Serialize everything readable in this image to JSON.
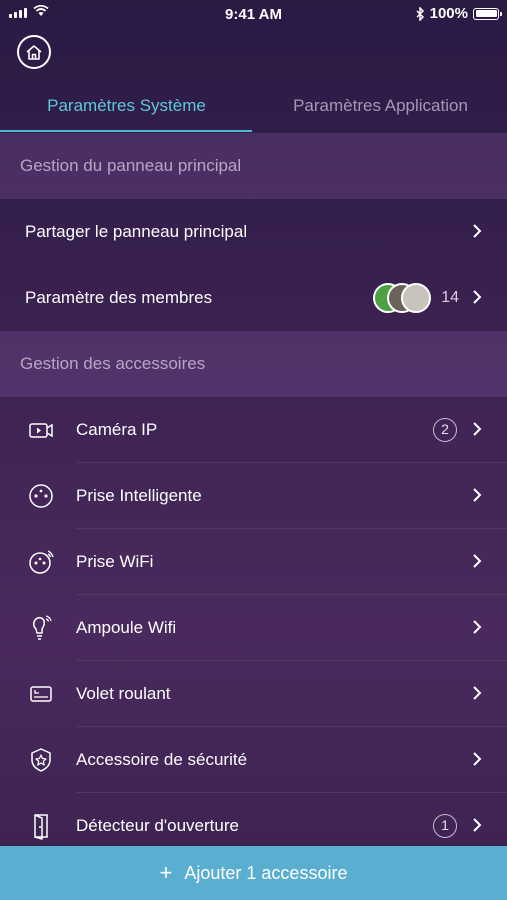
{
  "status_bar": {
    "time": "9:41 AM",
    "battery": "100%",
    "battery_level": 1.0
  },
  "tabs": [
    {
      "label": "Paramètres Système",
      "active": true
    },
    {
      "label": "Paramètres Application",
      "active": false
    }
  ],
  "sections": {
    "main_panel": {
      "title": "Gestion du panneau principal",
      "items": {
        "share": {
          "label": "Partager le panneau principal"
        },
        "members": {
          "label": "Paramètre des membres",
          "count": "14"
        }
      }
    },
    "accessories": {
      "title": "Gestion des accessoires",
      "items": [
        {
          "label": "Caméra IP",
          "icon": "camera-icon",
          "badge": "2"
        },
        {
          "label": "Prise Intelligente",
          "icon": "smart-plug-icon"
        },
        {
          "label": "Prise WiFi",
          "icon": "wifi-plug-icon"
        },
        {
          "label": "Ampoule Wifi",
          "icon": "bulb-icon"
        },
        {
          "label": "Volet roulant",
          "icon": "shutter-icon"
        },
        {
          "label": "Accessoire de sécurité",
          "icon": "security-shield-icon"
        },
        {
          "label": "Détecteur d'ouverture",
          "icon": "door-sensor-icon",
          "badge": "1"
        }
      ]
    }
  },
  "add_button": {
    "label": "Ajouter 1 accessoire",
    "icon": "plus-icon"
  },
  "colors": {
    "accent": "#5fc6dc",
    "add_bar": "#5aaed0",
    "background": "#3a2150"
  }
}
